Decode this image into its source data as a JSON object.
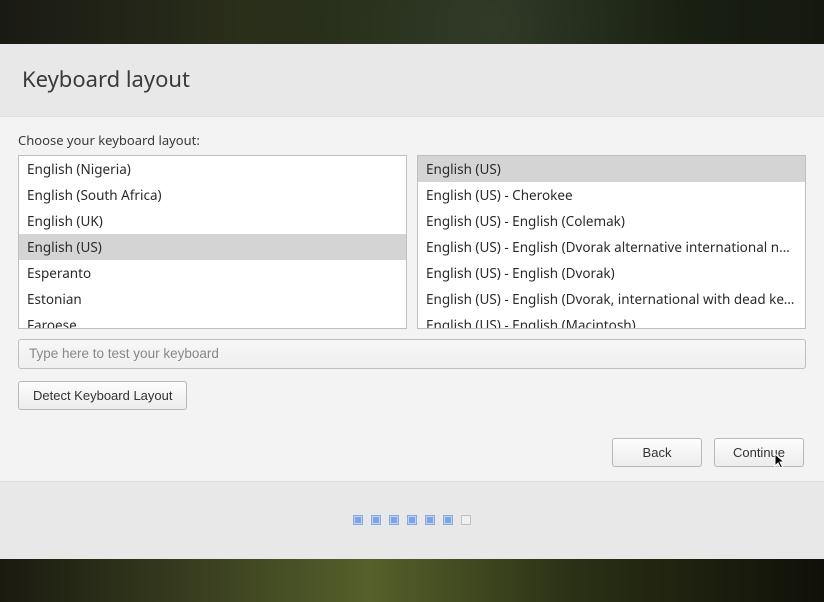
{
  "header": {
    "title": "Keyboard layout"
  },
  "content": {
    "prompt": "Choose your keyboard layout:",
    "left_list": {
      "items": [
        "English (Nigeria)",
        "English (South Africa)",
        "English (UK)",
        "English (US)",
        "Esperanto",
        "Estonian",
        "Faroese"
      ],
      "selected_index": 3
    },
    "right_list": {
      "items": [
        "English (US)",
        "English (US) - Cherokee",
        "English (US) - English (Colemak)",
        "English (US) - English (Dvorak alternative international no dead keys)",
        "English (US) - English (Dvorak)",
        "English (US) - English (Dvorak, international with dead keys)",
        "English (US) - English (Macintosh)"
      ],
      "selected_index": 0
    },
    "test_placeholder": "Type here to test your keyboard",
    "detect_label": "Detect Keyboard Layout",
    "back_label": "Back",
    "continue_label": "Continue"
  },
  "progress": {
    "total": 7,
    "completed": 6
  }
}
